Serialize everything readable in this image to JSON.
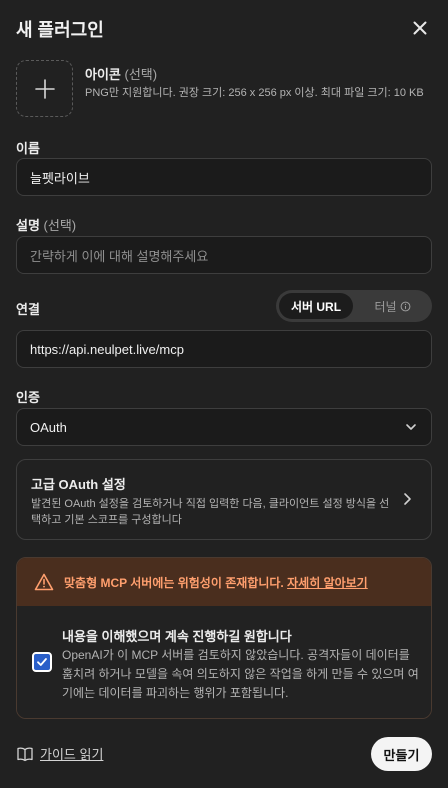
{
  "dialog": {
    "title": "새 플러그인"
  },
  "icon_field": {
    "label": "아이콘",
    "optional": "(선택)",
    "description": "PNG만 지원합니다. 권장 크기: 256 x 256 px 이상. 최대 파일 크기: 10 KB"
  },
  "name_field": {
    "label": "이름",
    "value": "늘펫라이브"
  },
  "desc_field": {
    "label": "설명",
    "optional": "(선택)",
    "placeholder": "간략하게 이에 대해 설명해주세요"
  },
  "connection": {
    "label": "연결",
    "modes": [
      "서버 URL",
      "터널"
    ],
    "selected": "서버 URL",
    "url": "https://api.neulpet.live/mcp"
  },
  "auth": {
    "label": "인증",
    "selected": "OAuth"
  },
  "advanced": {
    "title": "고급 OAuth 설정",
    "description": "발견된 OAuth 설정을 검토하거나 직접 입력한 다음, 클라이언트 설정 방식을 선택하고 기본 스코프를 구성합니다"
  },
  "warning": {
    "text": "맞춤형 MCP 서버에는 위험성이 존재합니다.",
    "link": "자세히 알아보기",
    "color": "#ff9f6e"
  },
  "acknowledge": {
    "checked": true,
    "title": "내용을 이해했으며 계속 진행하길 원합니다",
    "description": "OpenAI가 이 MCP 서버를 검토하지 않았습니다. 공격자들이 데이터를 훔치려 하거나 모델을 속여 의도하지 않은 작업을 하게 만들 수 있으며 여기에는 데이터를 파괴하는 행위가 포함됩니다."
  },
  "footer": {
    "guide": "가이드 읽기",
    "create": "만들기"
  },
  "icons": [
    "close-icon",
    "plus-icon",
    "info-icon",
    "chevron-down-icon",
    "chevron-right-icon",
    "warning-icon",
    "check-icon",
    "book-icon"
  ]
}
